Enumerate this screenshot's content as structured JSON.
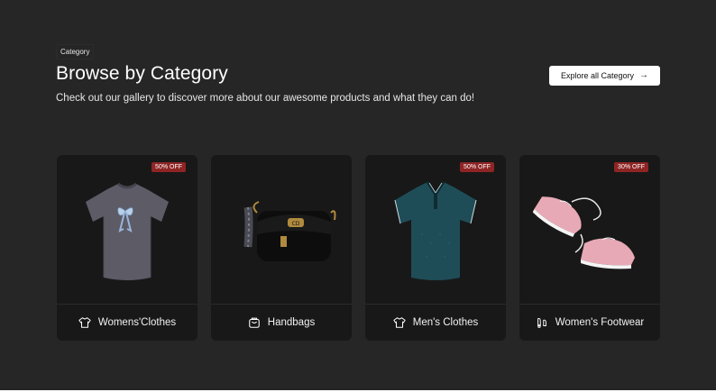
{
  "header": {
    "eyebrow": "Category",
    "title": "Browse by Category",
    "subtitle": "Check out our gallery to discover more about our awesome products and what they can do!",
    "explore_label": "Explore all Category"
  },
  "categories": [
    {
      "label": "Womens'Clothes",
      "badge": "50% OFF",
      "icon": "tshirt-icon",
      "image": "grey-tshirt-bow"
    },
    {
      "label": "Handbags",
      "badge": "",
      "icon": "bag-icon",
      "image": "black-handbag"
    },
    {
      "label": "Men's Clothes",
      "badge": "50% OFF",
      "icon": "tshirt-icon",
      "image": "teal-polo"
    },
    {
      "label": "Women's Footwear",
      "badge": "30% OFF",
      "icon": "footprints-icon",
      "image": "pink-sneakers"
    }
  ],
  "colors": {
    "background": "#262626",
    "card": "#181818",
    "badge": "#8e2424",
    "button": "#ffffff"
  }
}
